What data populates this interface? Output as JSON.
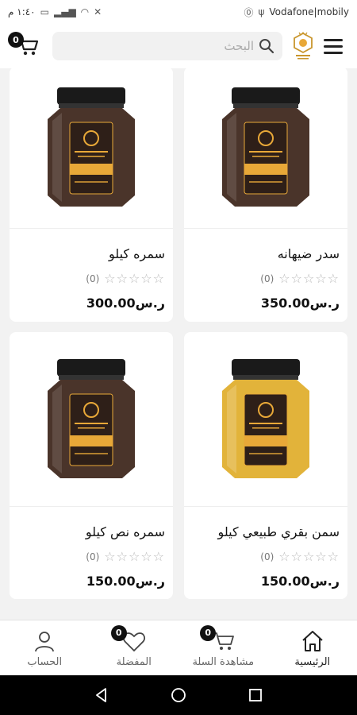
{
  "status_bar": {
    "time": "١:٤٠ م",
    "carrier": "Vodafone|mobily"
  },
  "header": {
    "search_placeholder": "البحث",
    "cart_count": "0",
    "logo_icon": "honey-logo-icon",
    "menu_icon": "hamburger-menu-icon"
  },
  "products": [
    {
      "name": "سدر ضيهانه",
      "rating_count": "(0)",
      "price": "350.00ر.س",
      "jar_color": "#4a342a"
    },
    {
      "name": "سمره كيلو",
      "rating_count": "(0)",
      "price": "300.00ر.س",
      "jar_color": "#4a342a"
    },
    {
      "name": "سمن بقري طبيعي كيلو",
      "rating_count": "(0)",
      "price": "150.00ر.س",
      "jar_color": "#e2b33a"
    },
    {
      "name": "سمره نص كيلو",
      "rating_count": "(0)",
      "price": "150.00ر.س",
      "jar_color": "#4a342a"
    }
  ],
  "bottom_nav": {
    "home": "الرئيسية",
    "cart": "مشاهدة السلة",
    "cart_count": "0",
    "favorites": "المفضلة",
    "favorites_count": "0",
    "account": "الحساب"
  },
  "colors": {
    "accent": "#111111",
    "honey_label": "#e8a838",
    "label_dark": "#2e1f18"
  }
}
